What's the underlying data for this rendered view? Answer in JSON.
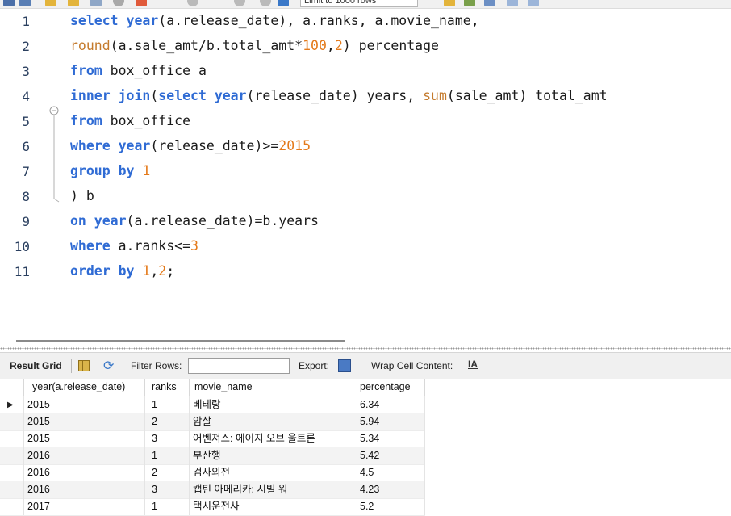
{
  "toolbar": {
    "limit_label": "Limit to 1000 rows",
    "icons": [
      "folder-icon",
      "save-icon",
      "lightning-icon",
      "lightning-cursor-icon",
      "search-plan-icon",
      "stop-icon",
      "toggle-icon",
      "commit-icon",
      "rollback-icon",
      "autocommit-icon",
      "beautify-icon",
      "find-icon",
      "invisible-chars-icon",
      "wrap-icon"
    ]
  },
  "editor": {
    "lines": [
      {
        "n": "1",
        "tokens": [
          {
            "t": "select ",
            "c": "kw"
          },
          {
            "t": "year",
            "c": "kw"
          },
          {
            "t": "(a.release_date), a.ranks, a.movie_name,",
            "c": ""
          }
        ]
      },
      {
        "n": "2",
        "tokens": [
          {
            "t": "round",
            "c": "fn"
          },
          {
            "t": "(a.sale_amt/b.total_amt*",
            "c": ""
          },
          {
            "t": "100",
            "c": "num"
          },
          {
            "t": ",",
            "c": ""
          },
          {
            "t": "2",
            "c": "num"
          },
          {
            "t": ") percentage",
            "c": ""
          }
        ]
      },
      {
        "n": "3",
        "tokens": [
          {
            "t": "from",
            "c": "kw"
          },
          {
            "t": " box_office a",
            "c": ""
          }
        ]
      },
      {
        "n": "4",
        "tokens": [
          {
            "t": "inner join",
            "c": "kw"
          },
          {
            "t": "(",
            "c": ""
          },
          {
            "t": "select year",
            "c": "kw"
          },
          {
            "t": "(release_date) years, ",
            "c": ""
          },
          {
            "t": "sum",
            "c": "fn"
          },
          {
            "t": "(sale_amt) total_amt",
            "c": ""
          }
        ]
      },
      {
        "n": "5",
        "tokens": [
          {
            "t": "from",
            "c": "kw"
          },
          {
            "t": " box_office",
            "c": ""
          }
        ]
      },
      {
        "n": "6",
        "tokens": [
          {
            "t": "where year",
            "c": "kw"
          },
          {
            "t": "(release_date)>=",
            "c": ""
          },
          {
            "t": "2015",
            "c": "num"
          }
        ]
      },
      {
        "n": "7",
        "tokens": [
          {
            "t": "group by ",
            "c": "kw"
          },
          {
            "t": "1",
            "c": "num"
          }
        ]
      },
      {
        "n": "8",
        "tokens": [
          {
            "t": ") b",
            "c": ""
          }
        ]
      },
      {
        "n": "9",
        "tokens": [
          {
            "t": "on year",
            "c": "kw"
          },
          {
            "t": "(a.release_date)=b.years",
            "c": ""
          }
        ]
      },
      {
        "n": "10",
        "tokens": [
          {
            "t": "where",
            "c": "kw"
          },
          {
            "t": " a.ranks<=",
            "c": ""
          },
          {
            "t": "3",
            "c": "num"
          }
        ]
      },
      {
        "n": "11",
        "tokens": [
          {
            "t": "order by ",
            "c": "kw"
          },
          {
            "t": "1",
            "c": "num"
          },
          {
            "t": ",",
            "c": ""
          },
          {
            "t": "2",
            "c": "num"
          },
          {
            "t": ";",
            "c": ""
          }
        ]
      }
    ]
  },
  "result_bar": {
    "result_grid_label": "Result Grid",
    "filter_label": "Filter Rows:",
    "filter_value": "",
    "export_label": "Export:",
    "wrap_label": "Wrap Cell Content:",
    "wrap_icon_text": "IA"
  },
  "grid": {
    "columns": [
      "year(a.release_date)",
      "ranks",
      "movie_name",
      "percentage"
    ],
    "rows": [
      [
        "2015",
        "1",
        "베테랑",
        "6.34"
      ],
      [
        "2015",
        "2",
        "암살",
        "5.94"
      ],
      [
        "2015",
        "3",
        "어벤져스: 에이지 오브 울트론",
        "5.34"
      ],
      [
        "2016",
        "1",
        "부산행",
        "5.42"
      ],
      [
        "2016",
        "2",
        "검사외전",
        "4.5"
      ],
      [
        "2016",
        "3",
        "캡틴 아메리카: 시빌 워",
        "4.23"
      ],
      [
        "2017",
        "1",
        "택시운전사",
        "5.2"
      ]
    ],
    "selected_row_marker": "▶"
  },
  "colors": {
    "keyword": "#2f6bd4",
    "function": "#c47a2c",
    "number": "#e47a1a"
  }
}
